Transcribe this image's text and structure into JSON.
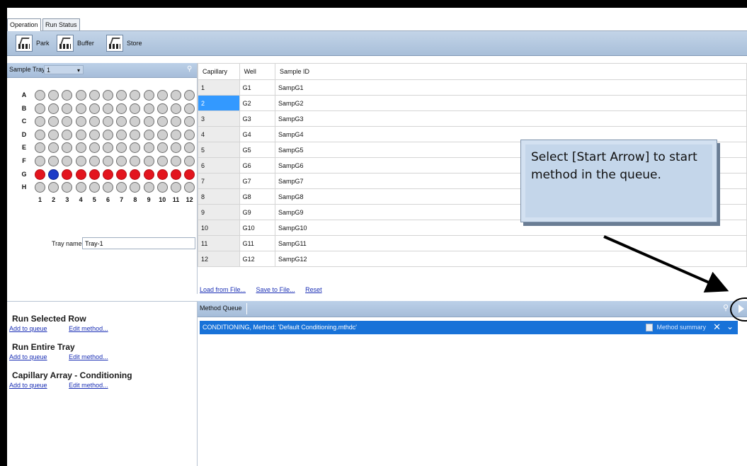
{
  "tabs": [
    {
      "label": "Operation",
      "active": true
    },
    {
      "label": "Run Status",
      "active": false
    }
  ],
  "toolbar": {
    "park_label": "Park",
    "buffer_label": "Buffer",
    "store_label": "Store"
  },
  "tray": {
    "header_label": "Sample Tray #",
    "selected_tray": "1",
    "rows": [
      "A",
      "B",
      "C",
      "D",
      "E",
      "F",
      "G",
      "H"
    ],
    "columns": [
      "1",
      "2",
      "3",
      "4",
      "5",
      "6",
      "7",
      "8",
      "9",
      "10",
      "11",
      "12"
    ],
    "highlight_row": "G",
    "selected_well": "G2",
    "row_color": "#e3151e",
    "selected_color": "#1d3cc7",
    "name_label": "Tray name",
    "name_value": "Tray-1"
  },
  "table": {
    "headers": [
      "Capillary",
      "Well",
      "Sample ID"
    ],
    "rows": [
      [
        "1",
        "G1",
        "SampG1"
      ],
      [
        "2",
        "G2",
        "SampG2"
      ],
      [
        "3",
        "G3",
        "SampG3"
      ],
      [
        "4",
        "G4",
        "SampG4"
      ],
      [
        "5",
        "G5",
        "SampG5"
      ],
      [
        "6",
        "G6",
        "SampG6"
      ],
      [
        "7",
        "G7",
        "SampG7"
      ],
      [
        "8",
        "G8",
        "SampG8"
      ],
      [
        "9",
        "G9",
        "SampG9"
      ],
      [
        "10",
        "G10",
        "SampG10"
      ],
      [
        "11",
        "G11",
        "SampG11"
      ],
      [
        "12",
        "G12",
        "SampG12"
      ]
    ],
    "selected_capillary": "2",
    "links": {
      "load": "Load from File...",
      "save": "Save to File...",
      "reset": "Reset"
    }
  },
  "run": {
    "sections": [
      {
        "title": "Run Selected Row",
        "add": "Add to queue",
        "edit": "Edit method..."
      },
      {
        "title": "Run Entire Tray",
        "add": "Add to queue",
        "edit": "Edit method..."
      },
      {
        "title": "Capillary Array - Conditioning",
        "add": "Add to queue",
        "edit": "Edit method..."
      }
    ]
  },
  "queue": {
    "header_label": "Method Queue",
    "item_text": "CONDITIONING, Method: 'Default Conditioning.mthdc'",
    "summary_label": "Method summary",
    "accent": "#1872d8"
  },
  "callout": {
    "text": "Select [Start Arrow] to start method in the queue."
  }
}
